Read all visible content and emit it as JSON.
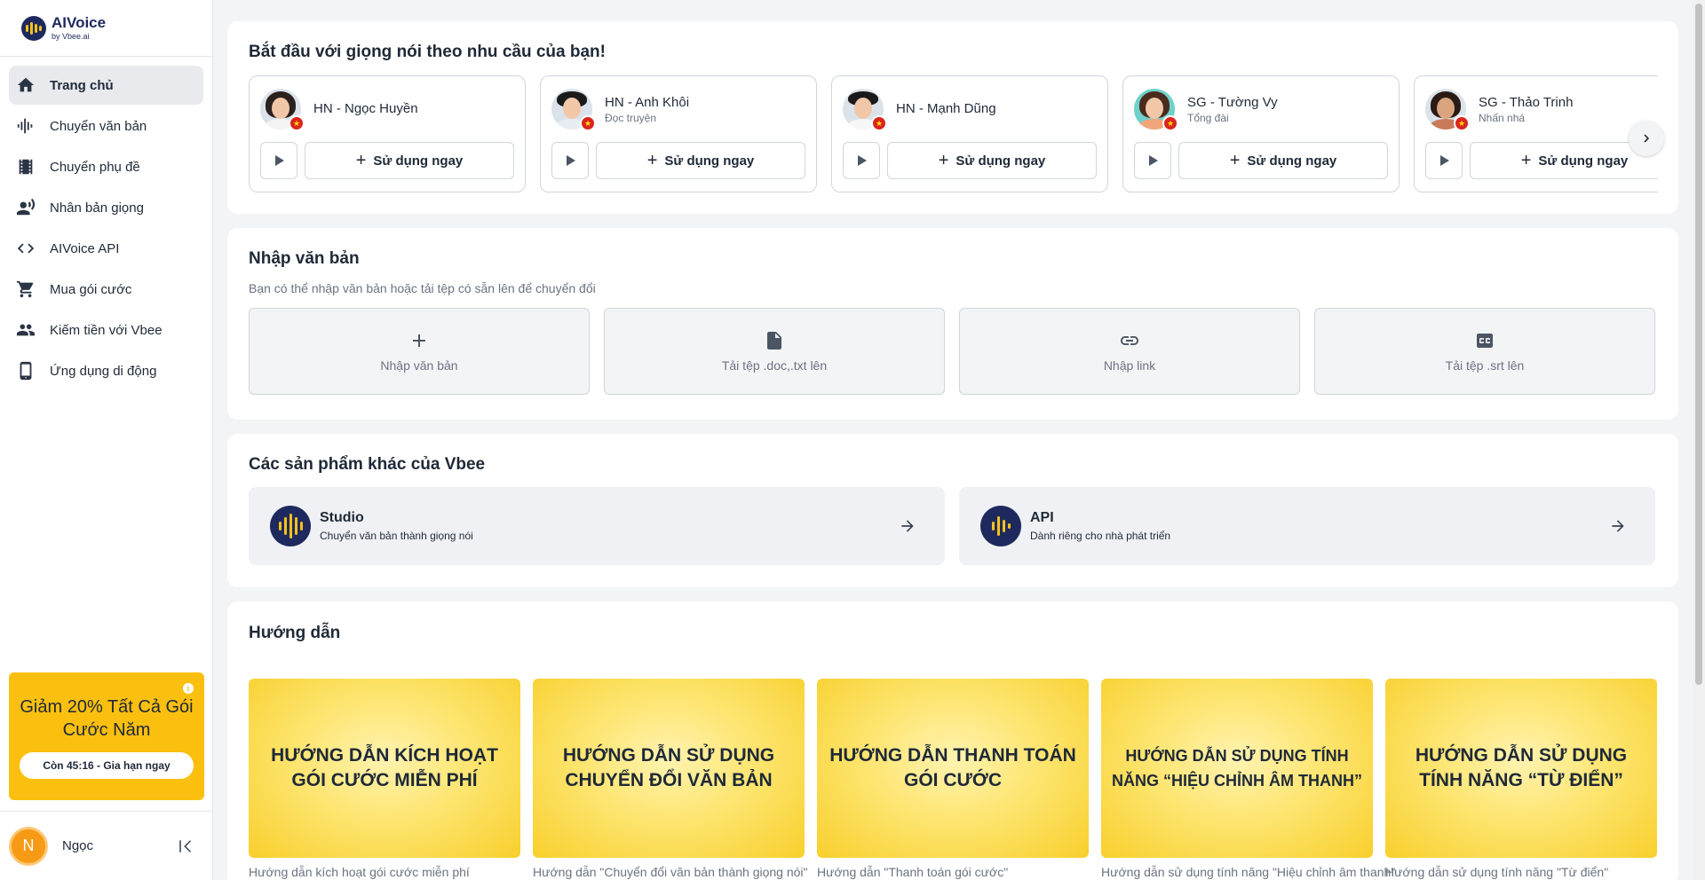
{
  "brand": {
    "name": "AIVoice",
    "byline": "by Vbee.ai"
  },
  "nav": {
    "items": [
      {
        "label": "Trang chủ"
      },
      {
        "label": "Chuyển văn bản"
      },
      {
        "label": "Chuyển phụ đề"
      },
      {
        "label": "Nhân bản giọng"
      },
      {
        "label": "AIVoice API"
      },
      {
        "label": "Mua gói cước"
      },
      {
        "label": "Kiếm tiền với Vbee"
      },
      {
        "label": "Ứng dụng di động"
      }
    ]
  },
  "promo": {
    "info": "i",
    "title": "Giảm 20% Tất Cả Gói Cước Năm",
    "button": "Còn 45:16 - Gia hạn ngay"
  },
  "user": {
    "initial": "N",
    "name": "Ngọc"
  },
  "voices": {
    "title": "Bắt đầu với giọng nói theo nhu cầu của bạn!",
    "use_label": "Sử dụng ngay",
    "items": [
      {
        "name": "HN - Ngọc Huyền",
        "style": ""
      },
      {
        "name": "HN - Anh Khôi",
        "style": "Đọc truyện"
      },
      {
        "name": "HN - Mạnh Dũng",
        "style": ""
      },
      {
        "name": "SG - Tường Vy",
        "style": "Tổng đài"
      },
      {
        "name": "SG - Thảo Trinh",
        "style": "Nhấn nhá"
      }
    ]
  },
  "input": {
    "title": "Nhập văn bản",
    "subtitle": "Bạn có thể nhập văn bản hoặc tải tệp có sẵn lên để chuyển đổi",
    "options": [
      {
        "label": "Nhập văn bản"
      },
      {
        "label": "Tải tệp .doc,.txt lên"
      },
      {
        "label": "Nhập link"
      },
      {
        "label": "Tải tệp .srt lên"
      }
    ]
  },
  "products": {
    "title": "Các sản phẩm khác của Vbee",
    "items": [
      {
        "name": "Studio",
        "desc": "Chuyển văn bản thành giọng nói"
      },
      {
        "name": "API",
        "desc": "Dành riêng cho nhà phát triển"
      }
    ]
  },
  "guides": {
    "title": "Hướng dẫn",
    "items": [
      {
        "thumb": "HƯỚNG DẪN KÍCH HOẠT GÓI CƯỚC MIỄN PHÍ",
        "caption": "Hướng dẫn kích hoạt gói cước miễn phí"
      },
      {
        "thumb": "HƯỚNG DẪN SỬ DỤNG CHUYỂN ĐỔI VĂN BẢN",
        "caption": "Hướng dẫn \"Chuyển đổi văn bản thành giọng nói\""
      },
      {
        "thumb": "HƯỚNG DẪN THANH TOÁN GÓI CƯỚC",
        "caption": "Hướng dẫn \"Thanh toán gói cước\""
      },
      {
        "thumb": "HƯỚNG DẪN SỬ DỤNG TÍNH NĂNG “HIỆU CHỈNH ÂM THANH”",
        "caption": "Hướng dẫn sử dụng tính năng \"Hiệu chỉnh âm thanh\""
      },
      {
        "thumb": "HƯỚNG DẪN SỬ DỤNG TÍNH NĂNG “TỪ ĐIỂN”",
        "caption": "Hướng dẫn sử dụng tính năng \"Từ điển\""
      }
    ]
  },
  "colors": {
    "accent": "#fbbf0f",
    "brand_navy": "#1e2a5e",
    "flag_red": "#da251d"
  }
}
